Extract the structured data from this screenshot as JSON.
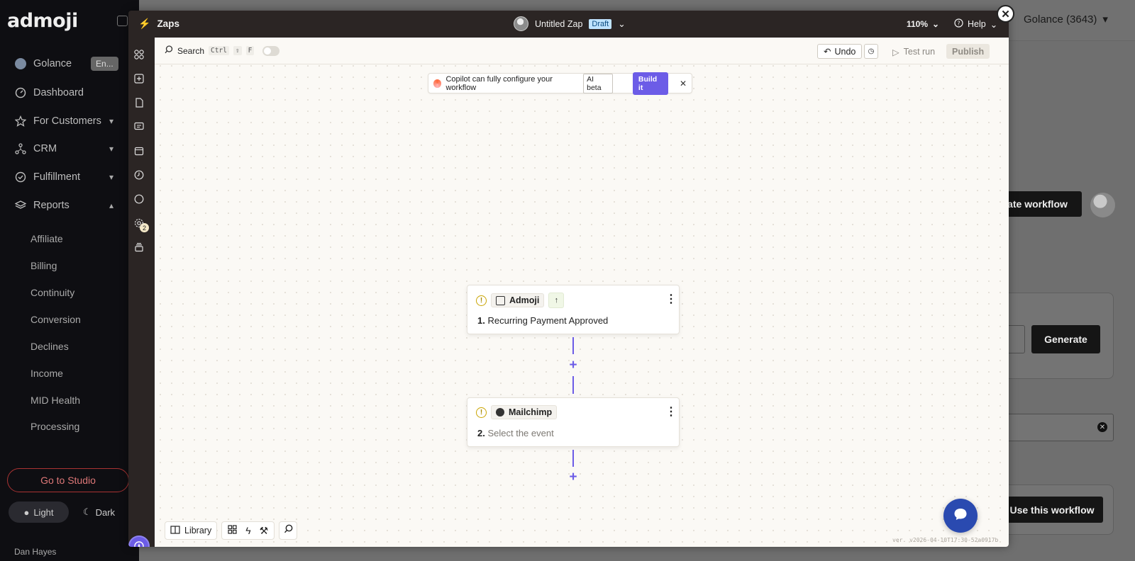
{
  "background_app": {
    "logo": "admoji",
    "account": "Golance (3643)",
    "org": {
      "name": "Golance",
      "env_badge": "En..."
    },
    "nav": [
      {
        "label": "Dashboard"
      },
      {
        "label": "For Customers"
      },
      {
        "label": "CRM"
      },
      {
        "label": "Fulfillment"
      },
      {
        "label": "Reports"
      }
    ],
    "reports_sub": [
      "Affiliate",
      "Billing",
      "Continuity",
      "Conversion",
      "Declines",
      "Income",
      "MID Health",
      "Processing"
    ],
    "studio_button": "Go to Studio",
    "theme": {
      "light": "Light",
      "dark": "Dark"
    },
    "user_name": "Dan Hayes",
    "create_workflow": "ate workflow",
    "generate_button": "Generate",
    "use_workflow": "Use this workflow"
  },
  "editor": {
    "app_name": "Zaps",
    "zap_title": "Untitled Zap",
    "status_badge": "Draft",
    "zoom": "110%",
    "help": "Help",
    "search": {
      "label": "Search",
      "shortcut": [
        "Ctrl",
        "⇧",
        "F"
      ]
    },
    "toolbar": {
      "undo": "Undo",
      "test_run": "Test run",
      "publish": "Publish"
    },
    "copilot": {
      "text": "Copilot can fully configure your workflow",
      "badge": "AI beta",
      "button": "Build it"
    },
    "rail_badge_count": "2",
    "steps": [
      {
        "app": "Admoji",
        "number": "1.",
        "title": "Recurring Payment Approved"
      },
      {
        "app": "Mailchimp",
        "number": "2.",
        "title": "Select the event"
      }
    ],
    "bottom": {
      "library": "Library"
    },
    "version": "ver. v2026-04-10T17:30-52a0917b"
  },
  "colors": {
    "accent": "#6c5ce7",
    "brand_orange": "#ff5a1f",
    "draft_badge": "#bfe3ff",
    "chat": "#2a4ab0"
  }
}
